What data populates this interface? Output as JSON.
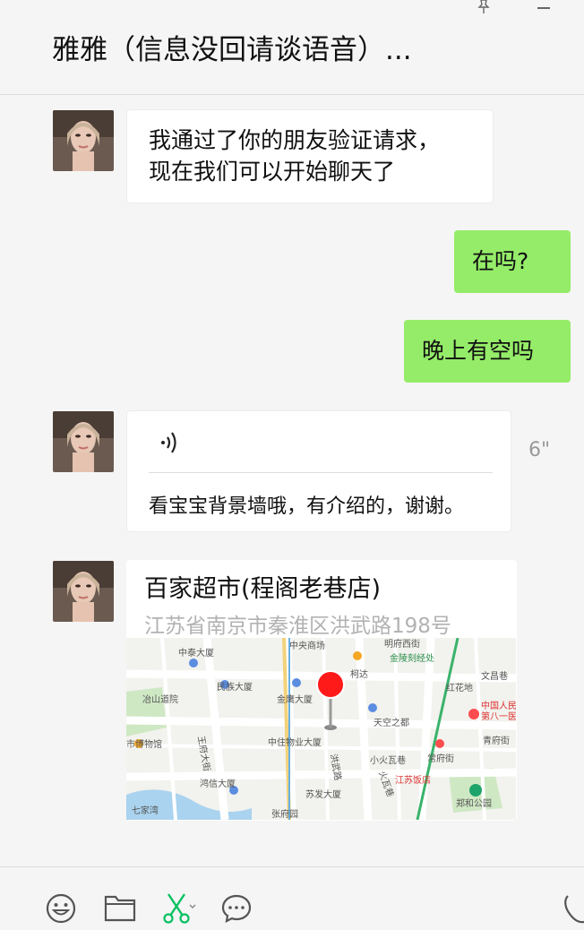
{
  "header": {
    "title": "雅雅（信息没回请谈语音）..."
  },
  "messages": [
    {
      "side": "left",
      "type": "text",
      "text_line1": "我通过了你的朋友验证请求，",
      "text_line2": "现在我们可以开始聊天了"
    },
    {
      "side": "right",
      "type": "text",
      "text": "在吗?"
    },
    {
      "side": "right",
      "type": "text",
      "text": "晚上有空吗"
    },
    {
      "side": "left",
      "type": "voice",
      "duration": "6\"",
      "transcript": "看宝宝背景墙哦，有介绍的，谢谢。"
    },
    {
      "side": "left",
      "type": "location",
      "name": "百家超市(程阁老巷店)",
      "address": "江苏省南京市秦淮区洪武路198号"
    }
  ],
  "map_labels": {
    "l1": "中泰大厦",
    "l2": "中央商场",
    "l3": "明府西街",
    "l4": "金陵刻经处",
    "l5": "文昌巷",
    "l6": "民族大厦",
    "l7": "柯达",
    "l8": "冶山道院",
    "l9": "金鹰大厦",
    "l10": "红花地",
    "l11": "中国人民",
    "l12": "第八一医",
    "l13": "天空之都",
    "l14": "青府街",
    "l15": "市博物馆",
    "l16": "中住物业大厦",
    "l17": "洪武路",
    "l18": "小火瓦巷",
    "l19": "常府街",
    "l20": "王府大街",
    "l21": "鸿信大厦",
    "l22": "苏发大厦",
    "l23": "江苏饭店",
    "l24": "郑和公园",
    "l25": "张府园",
    "l26": "七家湾",
    "l27": "火瓦巷"
  },
  "colors": {
    "accent": "#95ec69",
    "bubble_white": "#ffffff",
    "icon_green": "#07c160",
    "pin_red": "#ff1a1a"
  },
  "icons": [
    "pin-icon",
    "minimize-icon",
    "voice-wave-icon",
    "location-pin-icon",
    "emoji-icon",
    "folder-icon",
    "scissors-icon",
    "chat-history-icon",
    "phone-icon"
  ]
}
